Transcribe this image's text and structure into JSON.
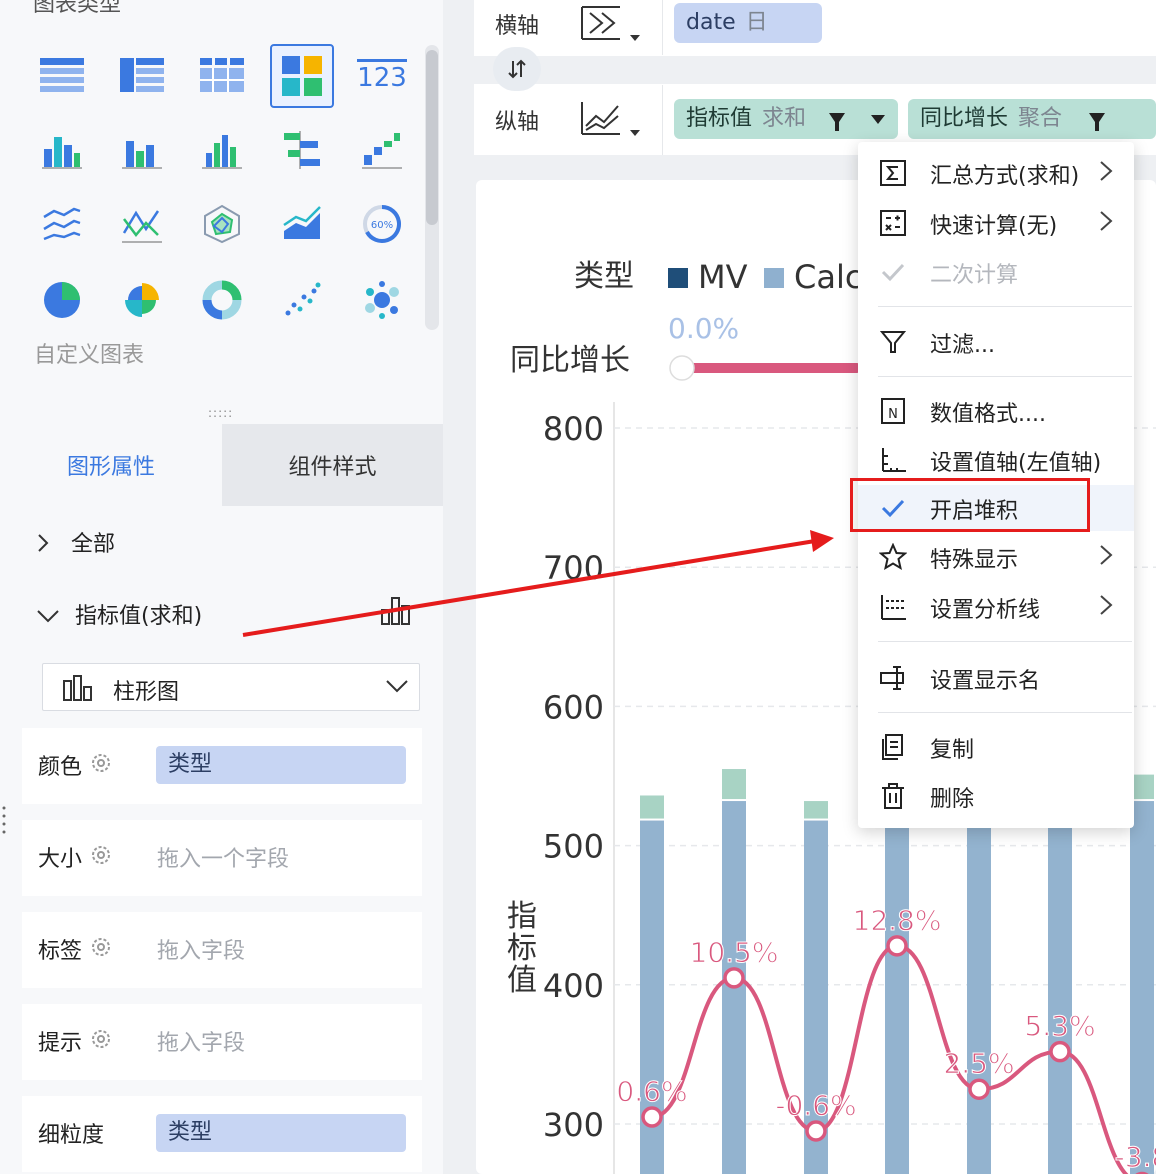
{
  "left_panel": {
    "chart_types_title": "图表类型",
    "custom_chart": "自定义图表",
    "drag_handle": ":::::",
    "kpi_icon_text": "123",
    "gauge_icon_text": "60%",
    "tabs": [
      "图形属性",
      "组件样式"
    ],
    "section_all": "全部",
    "section_metric": "指标值(求和)",
    "chart_kind": "柱形图",
    "props": [
      {
        "label": "颜色",
        "value": "类型",
        "placeholder": ""
      },
      {
        "label": "大小",
        "value": "",
        "placeholder": "拖入一个字段"
      },
      {
        "label": "标签",
        "value": "",
        "placeholder": "拖入字段"
      },
      {
        "label": "提示",
        "value": "",
        "placeholder": "拖入字段"
      },
      {
        "label": "细粒度",
        "value": "类型",
        "placeholder": ""
      }
    ]
  },
  "axes": {
    "x_label": "横轴",
    "y_label": "纵轴",
    "x_field": {
      "name": "date",
      "agg": "日"
    },
    "y_fields": [
      {
        "name": "指标值",
        "agg": "求和"
      },
      {
        "name": "同比增长",
        "agg": "聚合"
      }
    ]
  },
  "menu": {
    "items": [
      {
        "label": "汇总方式(求和)",
        "icon": "sigma-icon",
        "submenu": true,
        "disabled": false
      },
      {
        "label": "快速计算(无)",
        "icon": "calculator-icon",
        "submenu": true,
        "disabled": false
      },
      {
        "label": "二次计算",
        "icon": "check-icon",
        "submenu": false,
        "disabled": true
      },
      {
        "label": "过滤...",
        "icon": "filter-icon",
        "submenu": false,
        "disabled": false
      },
      {
        "label": "数值格式....",
        "icon": "number-format-icon",
        "submenu": false,
        "disabled": false
      },
      {
        "label": "设置值轴(左值轴)",
        "icon": "value-axis-icon",
        "submenu": false,
        "disabled": false
      },
      {
        "label": "开启堆积",
        "icon": "check-icon",
        "submenu": false,
        "disabled": false
      },
      {
        "label": "特殊显示",
        "icon": "star-icon",
        "submenu": true,
        "disabled": false
      },
      {
        "label": "设置分析线",
        "icon": "analysis-line-icon",
        "submenu": true,
        "disabled": false
      },
      {
        "label": "设置显示名",
        "icon": "rename-icon",
        "submenu": false,
        "disabled": false
      },
      {
        "label": "复制",
        "icon": "copy-icon",
        "submenu": false,
        "disabled": false
      },
      {
        "label": "删除",
        "icon": "trash-icon",
        "submenu": false,
        "disabled": false
      }
    ],
    "arrow_glyph": "›"
  },
  "chart_data": {
    "type": "bar",
    "legend_title": "类型",
    "legend": [
      {
        "name": "MV",
        "color": "#1f4e79"
      },
      {
        "name": "Calc",
        "color": "#8fb0cf"
      }
    ],
    "slider_title": "同比增长",
    "slider_value": "0.0%",
    "yaxis_label": "指标值",
    "yticks": [
      300,
      400,
      500,
      600,
      700,
      800
    ],
    "ylim": [
      250,
      810
    ],
    "grid": true,
    "series": [
      {
        "name": "bar-base",
        "color": "#93b3cf",
        "values": [
          518,
          532,
          518,
          null,
          null,
          null,
          null,
          532
        ]
      },
      {
        "name": "bar-top",
        "color": "#a8d3c4",
        "values": [
          18,
          23,
          14,
          null,
          null,
          null,
          null,
          19
        ]
      },
      {
        "name": "line",
        "color": "#d9587e",
        "values": [
          305,
          405,
          295,
          428,
          325,
          352,
          null,
          258
        ]
      }
    ],
    "labels": [
      "0.6%",
      "10.5%",
      "-0.6%",
      "12.8%",
      "2.5%",
      "5.3%",
      null,
      "-3.8"
    ]
  }
}
